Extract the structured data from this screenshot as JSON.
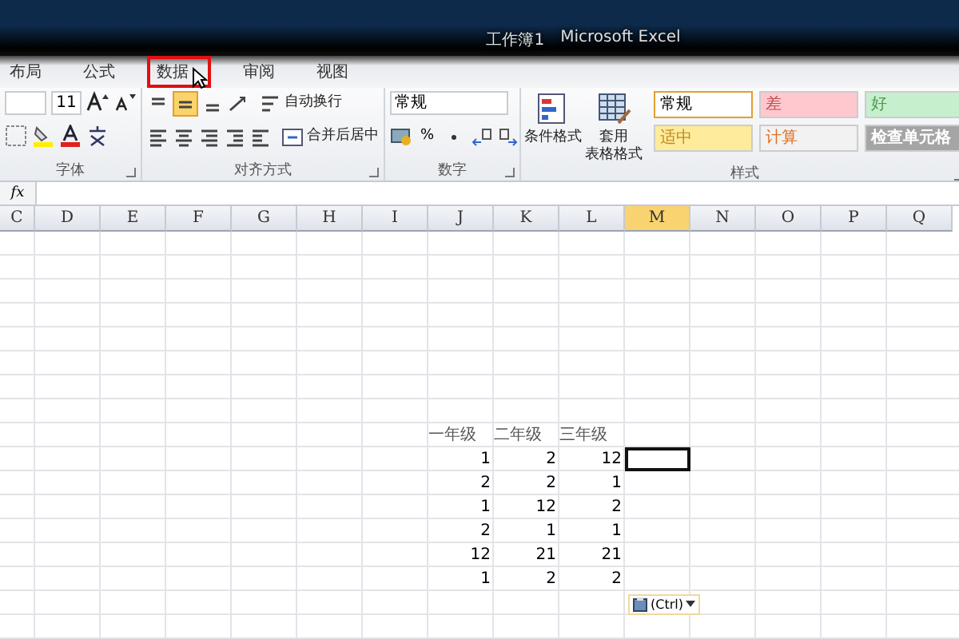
{
  "window": {
    "title": "工作簿1",
    "app": "Microsoft Excel"
  },
  "tabs": [
    {
      "label": "布局",
      "selected": false,
      "highlighted": false
    },
    {
      "label": "公式",
      "selected": false,
      "highlighted": false
    },
    {
      "label": "数据",
      "selected": false,
      "highlighted": true
    },
    {
      "label": "审阅",
      "selected": false,
      "highlighted": false
    },
    {
      "label": "视图",
      "selected": false,
      "highlighted": false
    }
  ],
  "ribbon": {
    "font": {
      "size": "11",
      "group_label": "字体"
    },
    "alignment": {
      "wrap_text": "自动换行",
      "merge_center": "合并后居中",
      "group_label": "对齐方式"
    },
    "number": {
      "format": "常规",
      "percent": "%",
      "group_label": "数字"
    },
    "styles": {
      "conditional_format": "条件格式",
      "table_format": [
        "套用",
        "表格格式"
      ],
      "cells": [
        {
          "label": "常规",
          "color": "#ffffff",
          "kind": "normal",
          "selected": true
        },
        {
          "label": "差",
          "color": "#ffc7ce",
          "kind": "bad",
          "selected": false
        },
        {
          "label": "好",
          "color": "#c6efce",
          "kind": "good",
          "selected": false
        },
        {
          "label": "适中",
          "color": "#ffeb9c",
          "kind": "neutral",
          "selected": false
        },
        {
          "label": "计算",
          "color": "#f2f2f2",
          "kind": "calculation",
          "selected": false
        },
        {
          "label": "检查单元格",
          "color": "#a5a5a5",
          "kind": "check",
          "selected": false
        }
      ],
      "group_label": "样式"
    }
  },
  "formula_bar": {
    "function_label": "fx"
  },
  "columns": [
    {
      "label": "C",
      "selected": false
    },
    {
      "label": "D",
      "selected": false
    },
    {
      "label": "E",
      "selected": false
    },
    {
      "label": "F",
      "selected": false
    },
    {
      "label": "G",
      "selected": false
    },
    {
      "label": "H",
      "selected": false
    },
    {
      "label": "I",
      "selected": false
    },
    {
      "label": "J",
      "selected": false
    },
    {
      "label": "K",
      "selected": false
    },
    {
      "label": "L",
      "selected": false
    },
    {
      "label": "M",
      "selected": true
    },
    {
      "label": "N",
      "selected": false
    },
    {
      "label": "O",
      "selected": false
    },
    {
      "label": "P",
      "selected": false
    },
    {
      "label": "Q",
      "selected": false
    }
  ],
  "data_table": {
    "header": [
      "一年级",
      "二年级",
      "三年级"
    ],
    "rows": [
      [
        "1",
        "2",
        "12"
      ],
      [
        "2",
        "2",
        "1"
      ],
      [
        "1",
        "12",
        "2"
      ],
      [
        "2",
        "1",
        "1"
      ],
      [
        "12",
        "21",
        "21"
      ],
      [
        "1",
        "2",
        "2"
      ]
    ]
  },
  "paste_options": {
    "label": "(Ctrl)"
  }
}
